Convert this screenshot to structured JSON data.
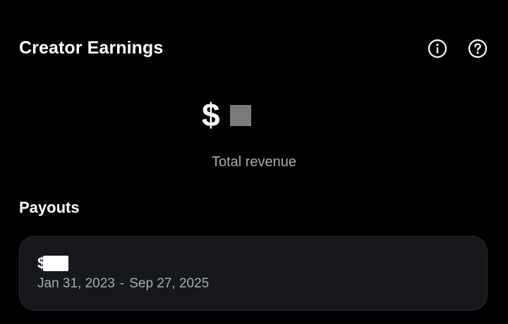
{
  "header": {
    "title": "Creator Earnings",
    "info_icon": "info-circle-icon",
    "help_icon": "question-circle-icon"
  },
  "revenue": {
    "currency": "$",
    "label": "Total revenue"
  },
  "payouts": {
    "title": "Payouts",
    "items": [
      {
        "currency": "$",
        "start_date": "Jan 31, 2023",
        "separator": "-",
        "end_date": "Sep 27, 2025"
      }
    ]
  },
  "colors": {
    "background": "#000000",
    "card": "#16181c",
    "primary_text": "#ffffff",
    "secondary_text": "#a5abb0"
  }
}
